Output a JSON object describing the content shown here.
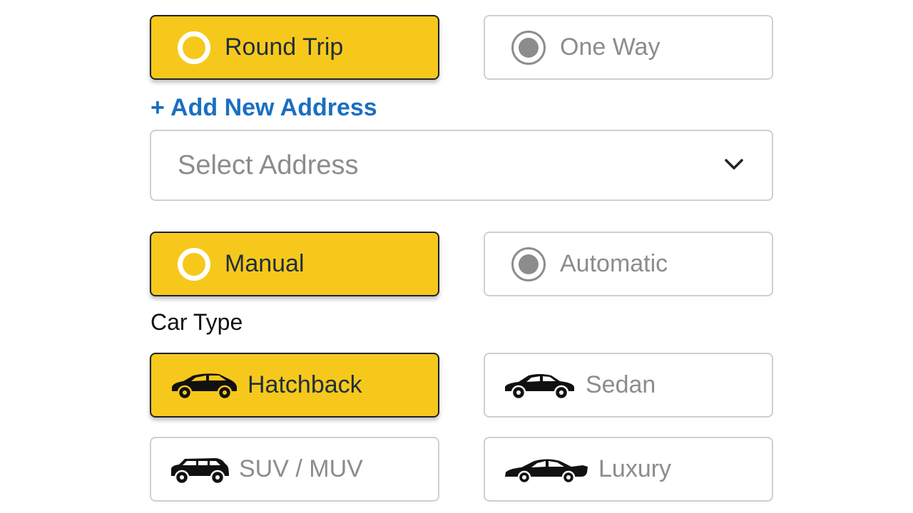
{
  "trip_type": {
    "options": [
      {
        "label": "Round Trip",
        "selected": true
      },
      {
        "label": "One Way",
        "selected": false
      }
    ]
  },
  "address": {
    "add_label": "+ Add New Address",
    "select_placeholder": "Select Address"
  },
  "transmission": {
    "options": [
      {
        "label": "Manual",
        "selected": true
      },
      {
        "label": "Automatic",
        "selected": false
      }
    ]
  },
  "car_type": {
    "heading": "Car Type",
    "options": [
      {
        "label": "Hatchback",
        "icon": "hatchback-car-icon",
        "selected": true
      },
      {
        "label": "Sedan",
        "icon": "sedan-car-icon",
        "selected": false
      },
      {
        "label": "SUV / MUV",
        "icon": "suv-car-icon",
        "selected": false
      },
      {
        "label": "Luxury",
        "icon": "luxury-car-icon",
        "selected": false
      }
    ]
  },
  "colors": {
    "selected_bg": "#f7c81c",
    "link": "#1a6fc0",
    "muted": "#8c8c8c"
  }
}
